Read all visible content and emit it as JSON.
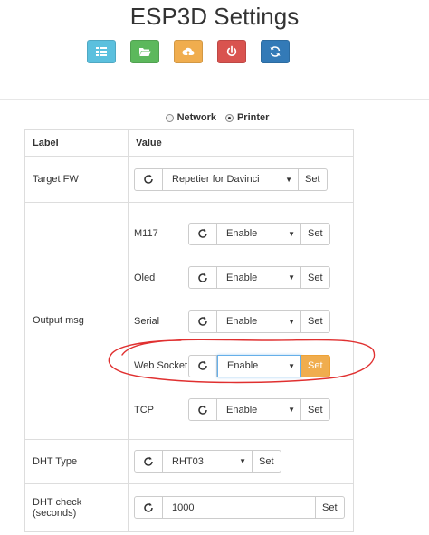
{
  "page": {
    "title": "ESP3D Settings"
  },
  "toolbar": {
    "buttons": [
      {
        "name": "list-button",
        "icon": "list-icon",
        "color": "#5bc0de"
      },
      {
        "name": "folder-button",
        "icon": "folder-open-icon",
        "color": "#5cb85c"
      },
      {
        "name": "upload-button",
        "icon": "cloud-upload-icon",
        "color": "#f0ad4e"
      },
      {
        "name": "power-button",
        "icon": "power-icon",
        "color": "#d9534f"
      },
      {
        "name": "refresh-button",
        "icon": "refresh-icon",
        "color": "#337ab7"
      }
    ]
  },
  "mode": {
    "network_label": "Network",
    "printer_label": "Printer",
    "selected": "Printer"
  },
  "table": {
    "headers": {
      "label": "Label",
      "value": "Value"
    },
    "target_fw": {
      "label": "Target FW",
      "value": "Repetier for Davinci",
      "set": "Set"
    },
    "output_msg": {
      "label": "Output msg",
      "items": [
        {
          "name": "M117",
          "value": "Enable",
          "set": "Set"
        },
        {
          "name": "Oled",
          "value": "Enable",
          "set": "Set"
        },
        {
          "name": "Serial",
          "value": "Enable",
          "set": "Set"
        },
        {
          "name": "Web Socket",
          "value": "Enable",
          "set": "Set"
        },
        {
          "name": "TCP",
          "value": "Enable",
          "set": "Set"
        }
      ]
    },
    "dht_type": {
      "label": "DHT Type",
      "value": "RHT03",
      "set": "Set"
    },
    "dht_check": {
      "label": "DHT check (seconds)",
      "value": "1000",
      "set": "Set"
    }
  },
  "colors": {
    "warning": "#f0ad4e",
    "annotation": "#e03030",
    "focus": "#66afe9"
  }
}
